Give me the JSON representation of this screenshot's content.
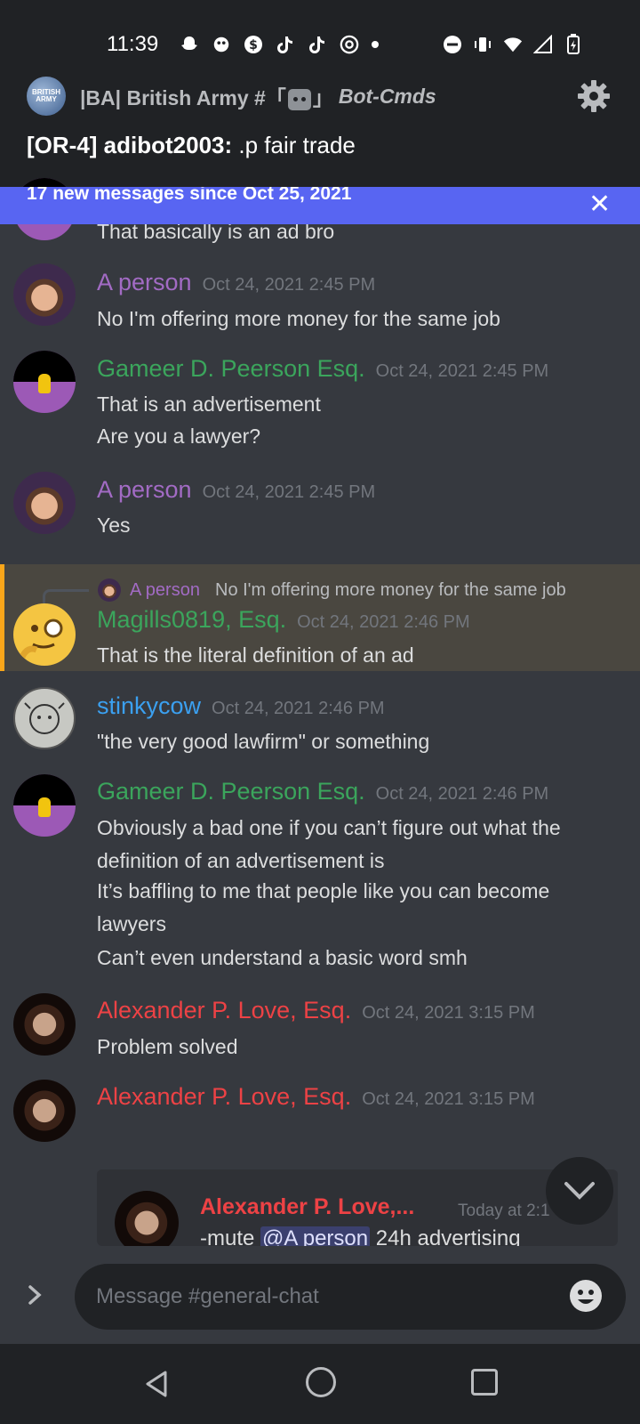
{
  "status": {
    "time": "11:39"
  },
  "header": {
    "server_icon_text": "BRITISH ARMY",
    "server_name": "|BA| British Army #「",
    "channel_suffix": "」",
    "channel_name": "Bot-Cmds",
    "topic_author": "[OR-4] adibot2003:",
    "topic_text": " .p fair trade"
  },
  "banner": {
    "text": "17 new messages since Oct 25, 2021",
    "close": "✕"
  },
  "messages": [
    {
      "lines": [
        "That basically is an ad bro"
      ]
    },
    {
      "author": "A person",
      "time": "Oct 24, 2021 2:45 PM",
      "lines": [
        "No I'm offering more money for the same job"
      ]
    },
    {
      "author": "Gameer D. Peerson Esq.",
      "time": "Oct 24, 2021 2:45 PM",
      "lines": [
        "That is an advertisement",
        "Are you a lawyer?"
      ]
    },
    {
      "author": "A person",
      "time": "Oct 24, 2021 2:45 PM",
      "lines": [
        "Yes"
      ]
    },
    {
      "author": "Magills0819, Esq.",
      "time": "Oct 24, 2021 2:46 PM",
      "lines": [
        "That is the literal definition of an ad"
      ],
      "reply": {
        "author": "A person",
        "text": "No I'm offering more money for the same job"
      }
    },
    {
      "author": "stinkycow",
      "time": "Oct 24, 2021 2:46 PM",
      "lines": [
        "\"the very good lawfirm\" or something"
      ]
    },
    {
      "author": "Gameer D. Peerson Esq.",
      "time": "Oct 24, 2021 2:46 PM",
      "lines": [
        "Obviously a bad one if you can’t figure out what the",
        "definition of an advertisement is",
        "It’s baffling to me that people like you can become",
        "lawyers",
        "Can’t even understand a basic word smh"
      ]
    },
    {
      "author": "Alexander P. Love, Esq.",
      "time": "Oct 24, 2021 3:15 PM",
      "lines": [
        "Problem solved"
      ]
    },
    {
      "author": "Alexander P. Love, Esq.",
      "time": "Oct 24, 2021 3:15 PM",
      "embed": {
        "author": "Alexander P. Love,...",
        "time": "Today at 2:1",
        "text_pre": "-mute ",
        "mention": "@A person",
        "text_post": " 24h advertising"
      }
    }
  ],
  "composer": {
    "placeholder": "Message #general-chat"
  },
  "colors": {
    "banner": "#5865f2",
    "highlight_bar": "#faa61a",
    "purple": "#a26bc4",
    "green": "#3ba55c",
    "blue": "#3ba0f0",
    "red": "#ed4245"
  }
}
